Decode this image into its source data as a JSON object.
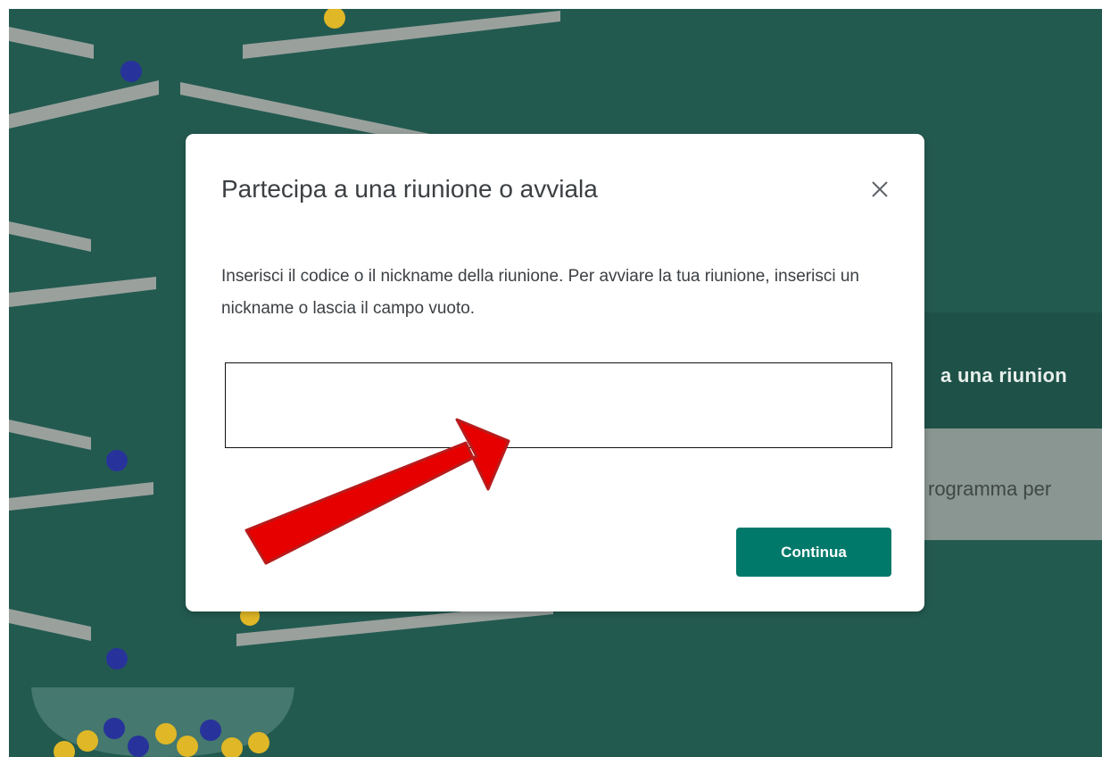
{
  "dialog": {
    "title": "Partecipa a una riunione o avviala",
    "description": "Inserisci il codice o il nickname della riunione. Per avviare la tua riunione, inserisci un nickname o lascia il campo vuoto.",
    "input_value": "",
    "input_placeholder": "",
    "close_icon": "close-icon",
    "continue_label": "Continua"
  },
  "background": {
    "join_button_partial": "a una riunion",
    "download_text_partial": "rogramma per"
  },
  "colors": {
    "background_teal": "#235a50",
    "primary_button": "#00796b",
    "annotation_arrow": "#e60000"
  }
}
